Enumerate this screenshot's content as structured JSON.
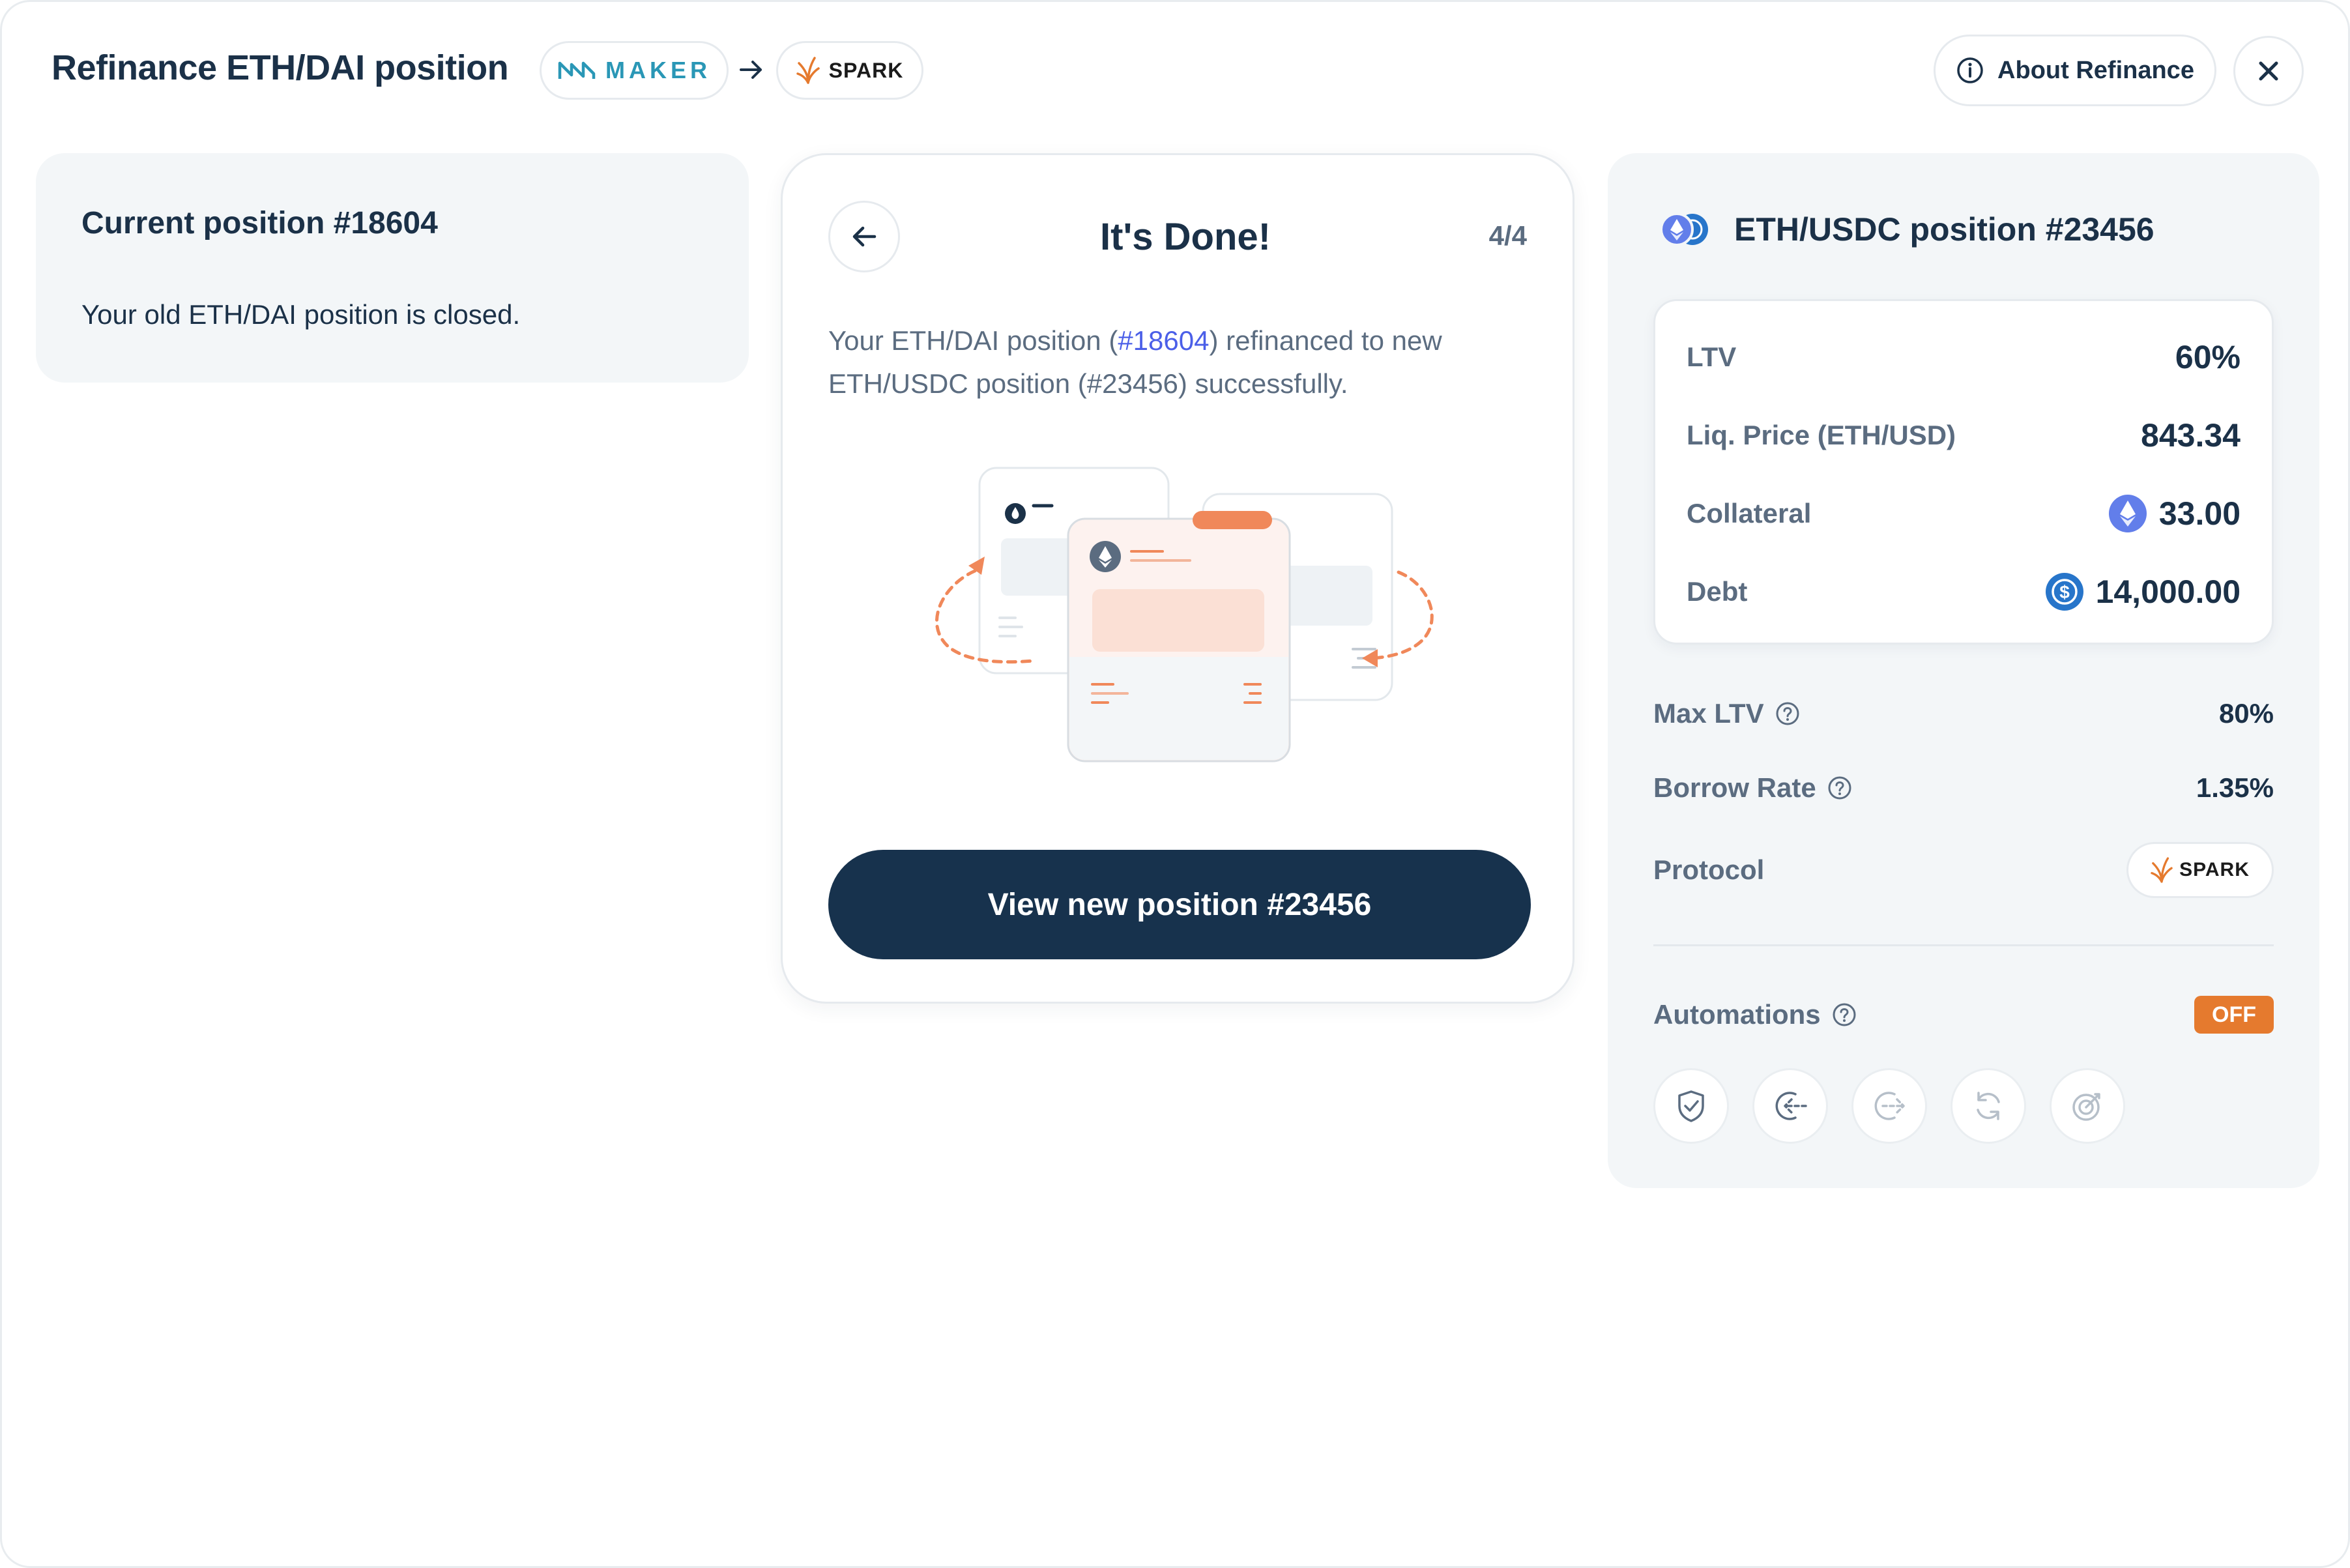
{
  "header": {
    "title": "Refinance ETH/DAI position",
    "from_protocol": "MAKER",
    "to_protocol": "SPARK",
    "about_label": "About Refinance"
  },
  "current_position": {
    "title": "Current position #18604",
    "message": "Your old ETH/DAI position is closed."
  },
  "done_card": {
    "title": "It's Done!",
    "step": "4/4",
    "desc_before": "Your ETH/DAI position (",
    "desc_link": "#18604",
    "desc_after": ") refinanced to new ETH/USDC position (#23456) successfully.",
    "button_label": "View new position #23456"
  },
  "new_position": {
    "title": "ETH/USDC position #23456",
    "stats": [
      {
        "label": "LTV",
        "value": "60%"
      },
      {
        "label": "Liq. Price (ETH/USD)",
        "value": "843.34"
      },
      {
        "label": "Collateral",
        "value": "33.00",
        "icon": "eth-icon"
      },
      {
        "label": "Debt",
        "value": "14,000.00",
        "icon": "usdc-icon"
      }
    ],
    "max_ltv": {
      "label": "Max LTV",
      "value": "80%"
    },
    "borrow_rate": {
      "label": "Borrow Rate",
      "value": "1.35%"
    },
    "protocol": {
      "label": "Protocol",
      "value": "SPARK"
    },
    "automations": {
      "label": "Automations",
      "status": "OFF"
    }
  },
  "colors": {
    "primary_dark": "#17324d",
    "accent_orange": "#e57a2e",
    "link_blue": "#4b5fe8",
    "maker_teal": "#2a97b6",
    "eth_blue": "#627eea",
    "usdc_blue": "#2775ca"
  }
}
